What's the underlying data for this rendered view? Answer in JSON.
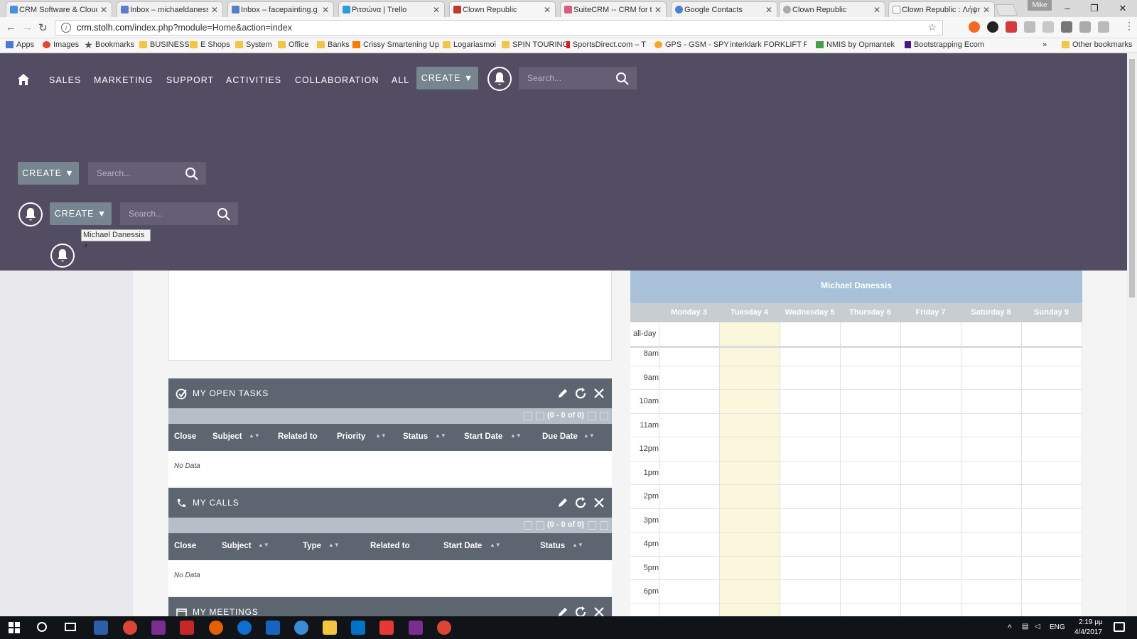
{
  "browser": {
    "tabs": [
      {
        "title": "CRM Software & Cloud",
        "color": "#4a90d9"
      },
      {
        "title": "Inbox – michaeldaness",
        "color": "#5b7fc7"
      },
      {
        "title": "Inbox – facepainting.g",
        "color": "#5b7fc7"
      },
      {
        "title": "Ριτσώνα | Trello",
        "color": "#2c9be0"
      },
      {
        "title": "Clown Republic",
        "color": "#c0392b"
      },
      {
        "title": "SuiteCRM -- CRM for t",
        "color": "#d35e7e"
      },
      {
        "title": "Google Contacts",
        "color": "#4a7fd4"
      },
      {
        "title": "Clown Republic",
        "color": "#aaaaaa"
      },
      {
        "title": "Clown Republic : Λήψη",
        "color": "#dddddd"
      }
    ],
    "user_badge": "Mike",
    "url_host": "crm.stolh.com",
    "url_path": "/index.php?module=Home&action=index",
    "bookmarks": [
      "Apps",
      "Images",
      "Bookmarks",
      "BUSINESS",
      "E Shops",
      "System",
      "Office",
      "Banks",
      "Crissy Smartening Up",
      "Logariasmoi",
      "SPIN TOURING",
      "SportsDirect.com – T",
      "GPS - GSM - SPY",
      "interklark FORKLIFT P",
      "NMIS by Opmantek",
      "Bootstrapping Ecom",
      "Other bookmarks"
    ],
    "bookmarks_overflow": "»"
  },
  "crm": {
    "nav": [
      "SALES",
      "MARKETING",
      "SUPPORT",
      "ACTIVITIES",
      "COLLABORATION",
      "ALL"
    ],
    "create_label": "CREATE ▼",
    "search_placeholder": "Search...",
    "user_name": "Michael Danessis"
  },
  "dashlets": {
    "tasks": {
      "title": "MY OPEN TASKS",
      "pager": "(0 - 0 of 0)",
      "columns": [
        "Close",
        "Subject",
        "Related to",
        "Priority",
        "Status",
        "Start Date",
        "Due Date"
      ],
      "empty": "No Data"
    },
    "calls": {
      "title": "MY CALLS",
      "pager": "(0 - 0 of 0)",
      "columns": [
        "Close",
        "Subject",
        "Type",
        "Related to",
        "Start Date",
        "Status"
      ],
      "empty": "No Data"
    },
    "meetings": {
      "title": "MY MEETINGS"
    }
  },
  "calendar": {
    "owner": "Michael Danessis",
    "days": [
      "Monday 3",
      "Tuesday 4",
      "Wednesday 5",
      "Thursday 6",
      "Friday 7",
      "Saturday 8",
      "Sunday 9"
    ],
    "allday_label": "all-day",
    "times": [
      "8am",
      "9am",
      "10am",
      "11am",
      "12pm",
      "1pm",
      "2pm",
      "3pm",
      "4pm",
      "5pm",
      "6pm"
    ]
  },
  "taskbar": {
    "lang": "ENG",
    "time": "2:19 μμ",
    "date": "4/4/2017"
  }
}
